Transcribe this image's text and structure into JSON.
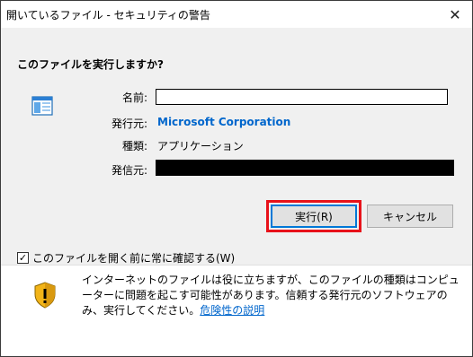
{
  "window": {
    "title": "開いているファイル - セキュリティの警告",
    "close_glyph": "✕"
  },
  "question": "このファイルを実行しますか?",
  "fields": {
    "name_label": "名前:",
    "name_value": "",
    "publisher_label": "発行元:",
    "publisher_value": "Microsoft Corporation",
    "type_label": "種類:",
    "type_value": "アプリケーション",
    "from_label": "発信元:",
    "from_value": ""
  },
  "buttons": {
    "run": "実行(R)",
    "cancel": "キャンセル"
  },
  "checkbox": {
    "label": "このファイルを開く前に常に確認する(W)",
    "checked": true,
    "check_glyph": "✓"
  },
  "warning": {
    "text": "インターネットのファイルは役に立ちますが、このファイルの種類はコンピューターに問題を起こす可能性があります。信頼する発行元のソフトウェアのみ、実行してください。",
    "link": "危険性の説明"
  },
  "colors": {
    "link": "#0066cc",
    "highlight": "#e8121a",
    "dialog_bg": "#f0f0f0"
  },
  "icons": {
    "app": "application-window-icon",
    "warning": "security-shield-icon"
  }
}
